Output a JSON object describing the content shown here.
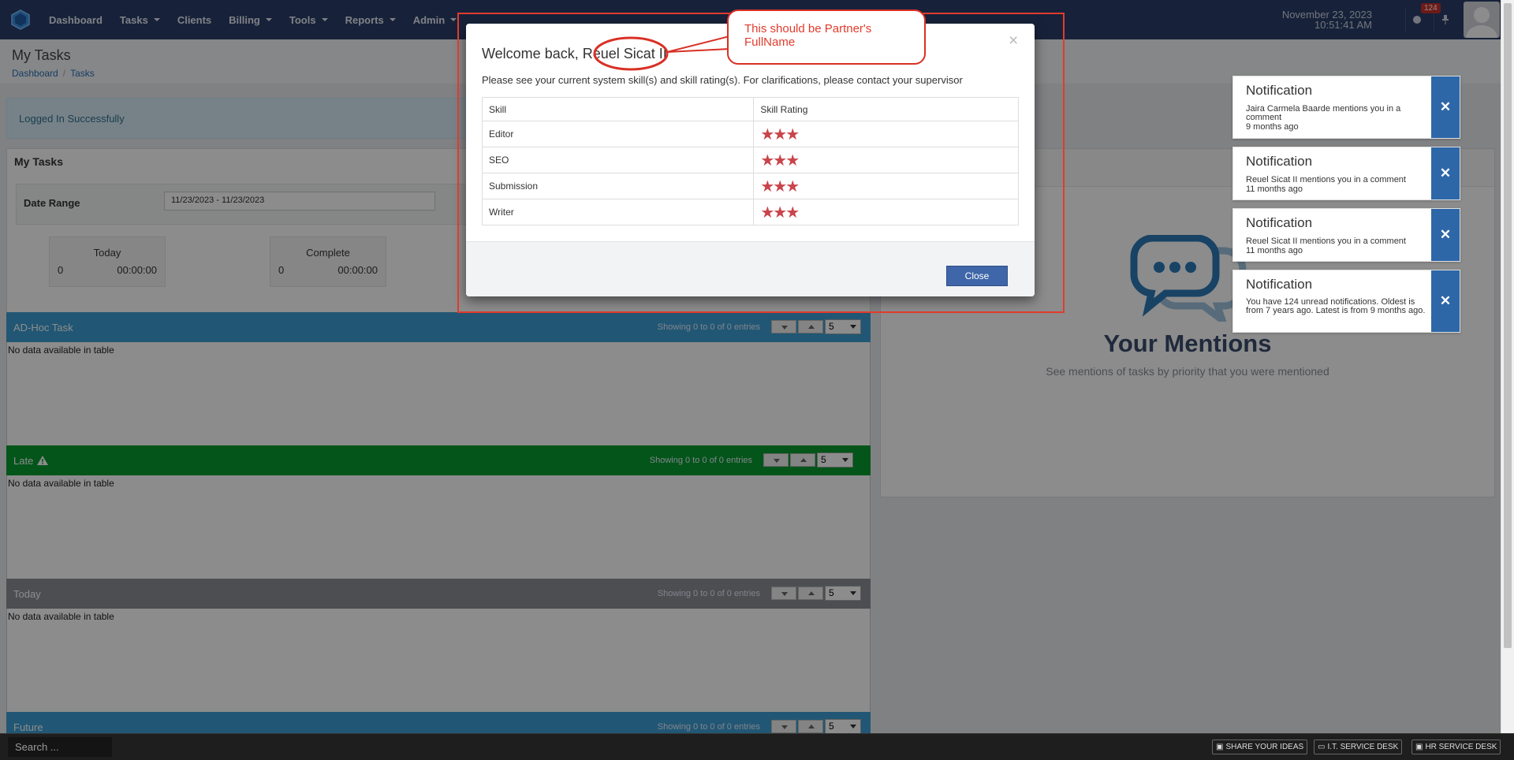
{
  "nav": {
    "items": [
      "Dashboard",
      "Tasks",
      "Clients",
      "Billing",
      "Tools",
      "Reports",
      "Admin"
    ],
    "date": "November 23, 2023",
    "time": "10:51:41 AM",
    "notification_count": "124",
    "icons": [
      "globe-icon",
      "pin-icon"
    ]
  },
  "page": {
    "title": "My Tasks",
    "breadcrumb": [
      "Dashboard",
      "Tasks"
    ]
  },
  "alert": "Logged In Successfully",
  "tasks_panel": {
    "title": "My Tasks",
    "date_range_label": "Date Range",
    "date_range_value": "11/23/2023 - 11/23/2023",
    "stats": [
      {
        "title": "Today",
        "count": "0",
        "time": "00:00:00"
      },
      {
        "title": "Complete",
        "count": "0",
        "time": "00:00:00"
      }
    ],
    "tables": [
      {
        "title": "AD-Hoc Task",
        "color": "#3d9fd4",
        "showing": "Showing 0 to 0 of 0 entries",
        "page_size": "5",
        "empty": "No data available in table"
      },
      {
        "title": "Late",
        "color": "#069c2e",
        "showing": "Showing 0 to 0 of 0 entries",
        "page_size": "5",
        "empty": "No data available in table"
      },
      {
        "title": "Today",
        "color": "#8a8f96",
        "showing": "Showing 0 to 0 of 0 entries",
        "page_size": "5",
        "empty": "No data available in table"
      },
      {
        "title": "Future",
        "color": "#3d9fd4",
        "showing": "Showing 0 to 0 of 0 entries",
        "page_size": "5",
        "empty": ""
      }
    ]
  },
  "mentions": {
    "title": "Your Mentions",
    "subtitle": "See mentions of tasks by priority that you were mentioned"
  },
  "notifications": [
    {
      "title": "Notification",
      "body": "Jaira Carmela Baarde mentions you in a comment",
      "ago": "9 months ago"
    },
    {
      "title": "Notification",
      "body": "Reuel Sicat II mentions you in a comment",
      "ago": "11 months ago"
    },
    {
      "title": "Notification",
      "body": "Reuel Sicat II mentions you in a comment",
      "ago": "11 months ago"
    },
    {
      "title": "Notification",
      "body": "You have 124 unread notifications. Oldest is from 7 years ago. Latest is from 9 months ago.",
      "ago": ""
    }
  ],
  "modal": {
    "title": "Welcome back, Reuel Sicat II",
    "text": "Please see your current system skill(s) and skill rating(s). For clarifications, please contact your supervisor",
    "columns": [
      "Skill",
      "Skill Rating"
    ],
    "skills": [
      {
        "name": "Editor",
        "rating": 3
      },
      {
        "name": "SEO",
        "rating": 3
      },
      {
        "name": "Submission",
        "rating": 3
      },
      {
        "name": "Writer",
        "rating": 3
      }
    ],
    "close_label": "Close"
  },
  "annotation": {
    "text": "This should be Partner's FullName",
    "color": "#e23b2d"
  },
  "footer": {
    "search_placeholder": "Search ...",
    "buttons": [
      "SHARE YOUR IDEAS",
      "I.T. SERVICE DESK",
      "HR SERVICE DESK"
    ]
  }
}
